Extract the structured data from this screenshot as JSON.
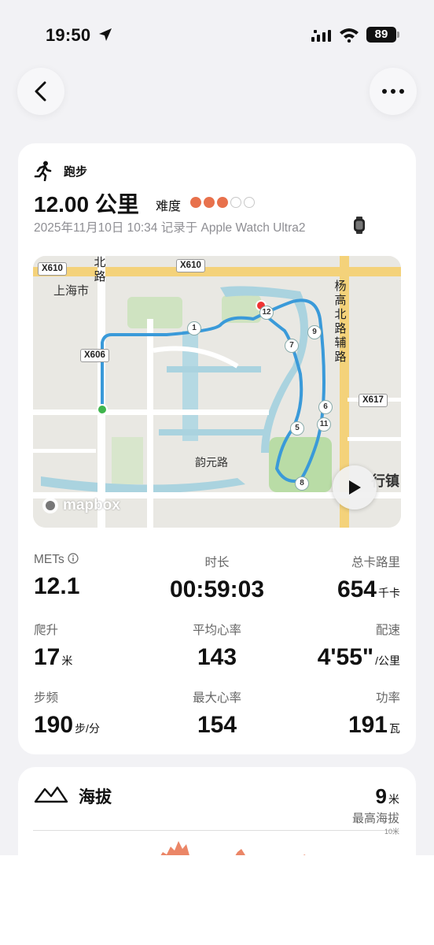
{
  "status_bar": {
    "time": "19:50",
    "battery": "89"
  },
  "workout": {
    "sport": "跑步",
    "distance": "12.00 公里",
    "difficulty_label": "难度",
    "difficulty_level": 3,
    "difficulty_max": 5,
    "record_line": "2025年11月10日  10:34  记录于 Apple Watch Ultra2",
    "accent_color": "#e8714c"
  },
  "map": {
    "labels": {
      "district": "上海市",
      "road_bei": "北路",
      "road_yunyuan": "韵元路",
      "road_yanggao": "杨高北路辅路",
      "town_partial": "行镇",
      "mapbox": "mapbox"
    },
    "road_badges": [
      "X610",
      "X610",
      "X606",
      "X617"
    ],
    "km_markers": [
      "1",
      "12",
      "7",
      "9",
      "6",
      "11",
      "5",
      "8"
    ]
  },
  "stats": [
    {
      "label": "METs",
      "value": "12.1",
      "unit": ""
    },
    {
      "label": "时长",
      "value": "00:59:03",
      "unit": ""
    },
    {
      "label": "总卡路里",
      "value": "654",
      "unit": "千卡"
    },
    {
      "label": "爬升",
      "value": "17",
      "unit": "米"
    },
    {
      "label": "平均心率",
      "value": "143",
      "unit": ""
    },
    {
      "label": "配速",
      "value": "4'55\"",
      "unit": "/公里"
    },
    {
      "label": "步频",
      "value": "190",
      "unit": "步/分"
    },
    {
      "label": "最大心率",
      "value": "154",
      "unit": ""
    },
    {
      "label": "功率",
      "value": "191",
      "unit": "瓦"
    }
  ],
  "altitude": {
    "title": "海拔",
    "max_value": "9",
    "max_unit": "米",
    "max_label": "最高海拔",
    "scale_label": "10米"
  }
}
